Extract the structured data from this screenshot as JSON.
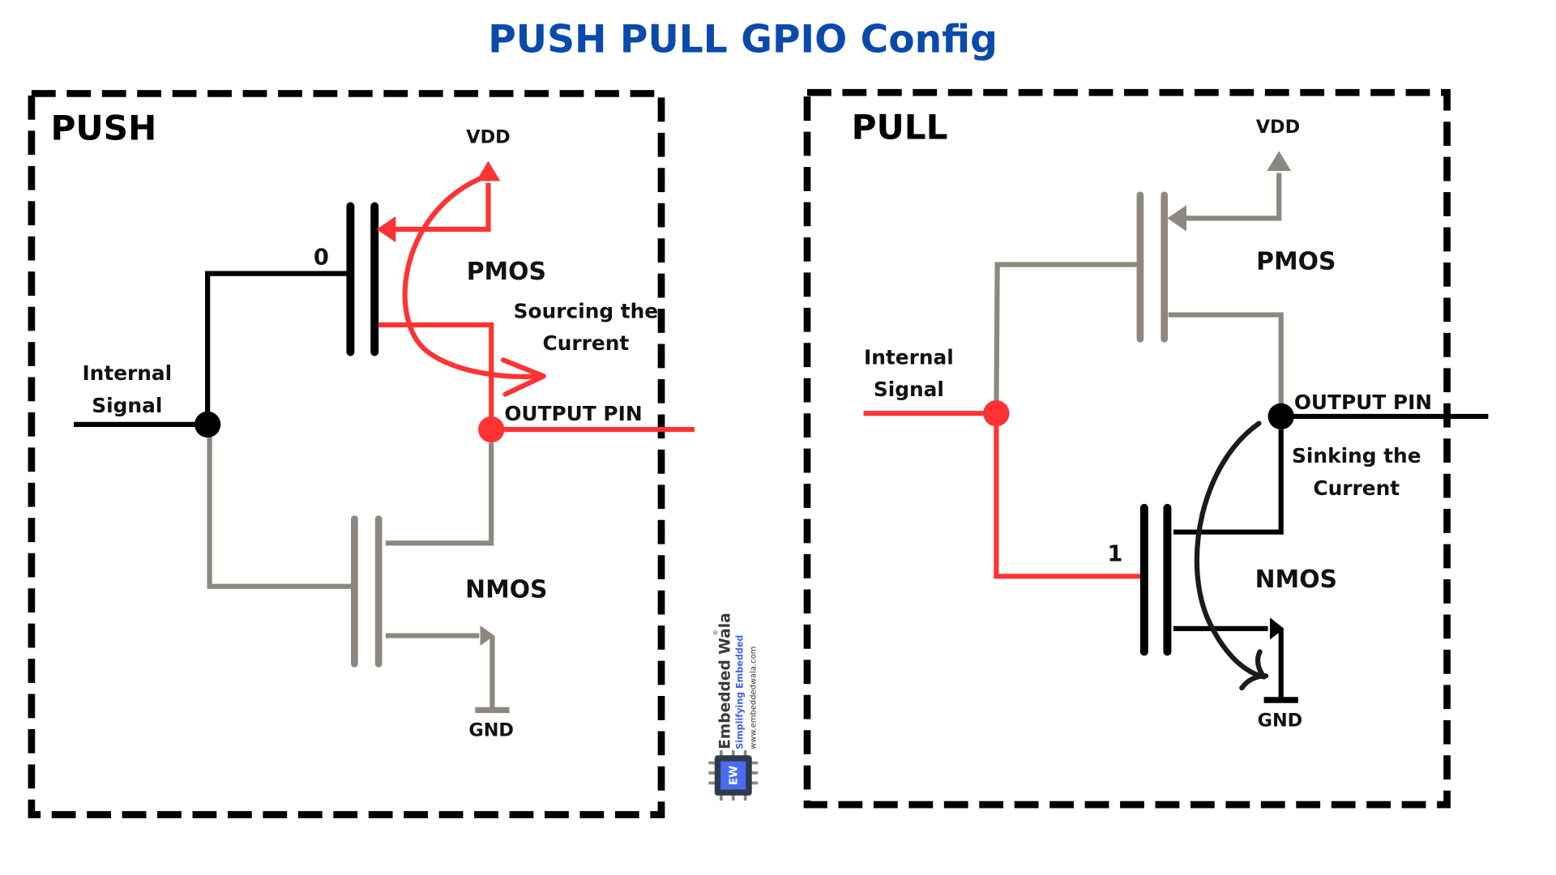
{
  "title": "PUSH PULL GPIO Config",
  "colors": {
    "title": "#0a4aad",
    "active": "#ff3333",
    "inactive": "#8c8880",
    "wire": "#000000",
    "arc_sink": "#1e1a18",
    "logo_chip": "#2f3b4c",
    "logo_chip_face": "#4a6cf0",
    "logo_sub": "#3f63f0"
  },
  "push_panel": {
    "title": "PUSH",
    "vdd_label": "VDD",
    "gnd_label": "GND",
    "pmos_label": "PMOS",
    "nmos_label": "NMOS",
    "gate_value": "0",
    "input_label_line1": "Internal",
    "input_label_line2": "Signal",
    "output_label": "OUTPUT PIN",
    "current_label_line1": "Sourcing the",
    "current_label_line2": "Current",
    "active_transistor": "PMOS"
  },
  "pull_panel": {
    "title": "PULL",
    "vdd_label": "VDD",
    "gnd_label": "GND",
    "pmos_label": "PMOS",
    "nmos_label": "NMOS",
    "gate_value": "1",
    "input_label_line1": "Internal",
    "input_label_line2": "Signal",
    "output_label": "OUTPUT PIN",
    "current_label_line1": "Sinking the",
    "current_label_line2": "Current",
    "active_transistor": "NMOS"
  },
  "logo": {
    "name": "Embedded Wala",
    "registered": "®",
    "tagline": "Simplifying Embedded",
    "url": "www.embeddedwala.com",
    "chip_text": "EW"
  }
}
